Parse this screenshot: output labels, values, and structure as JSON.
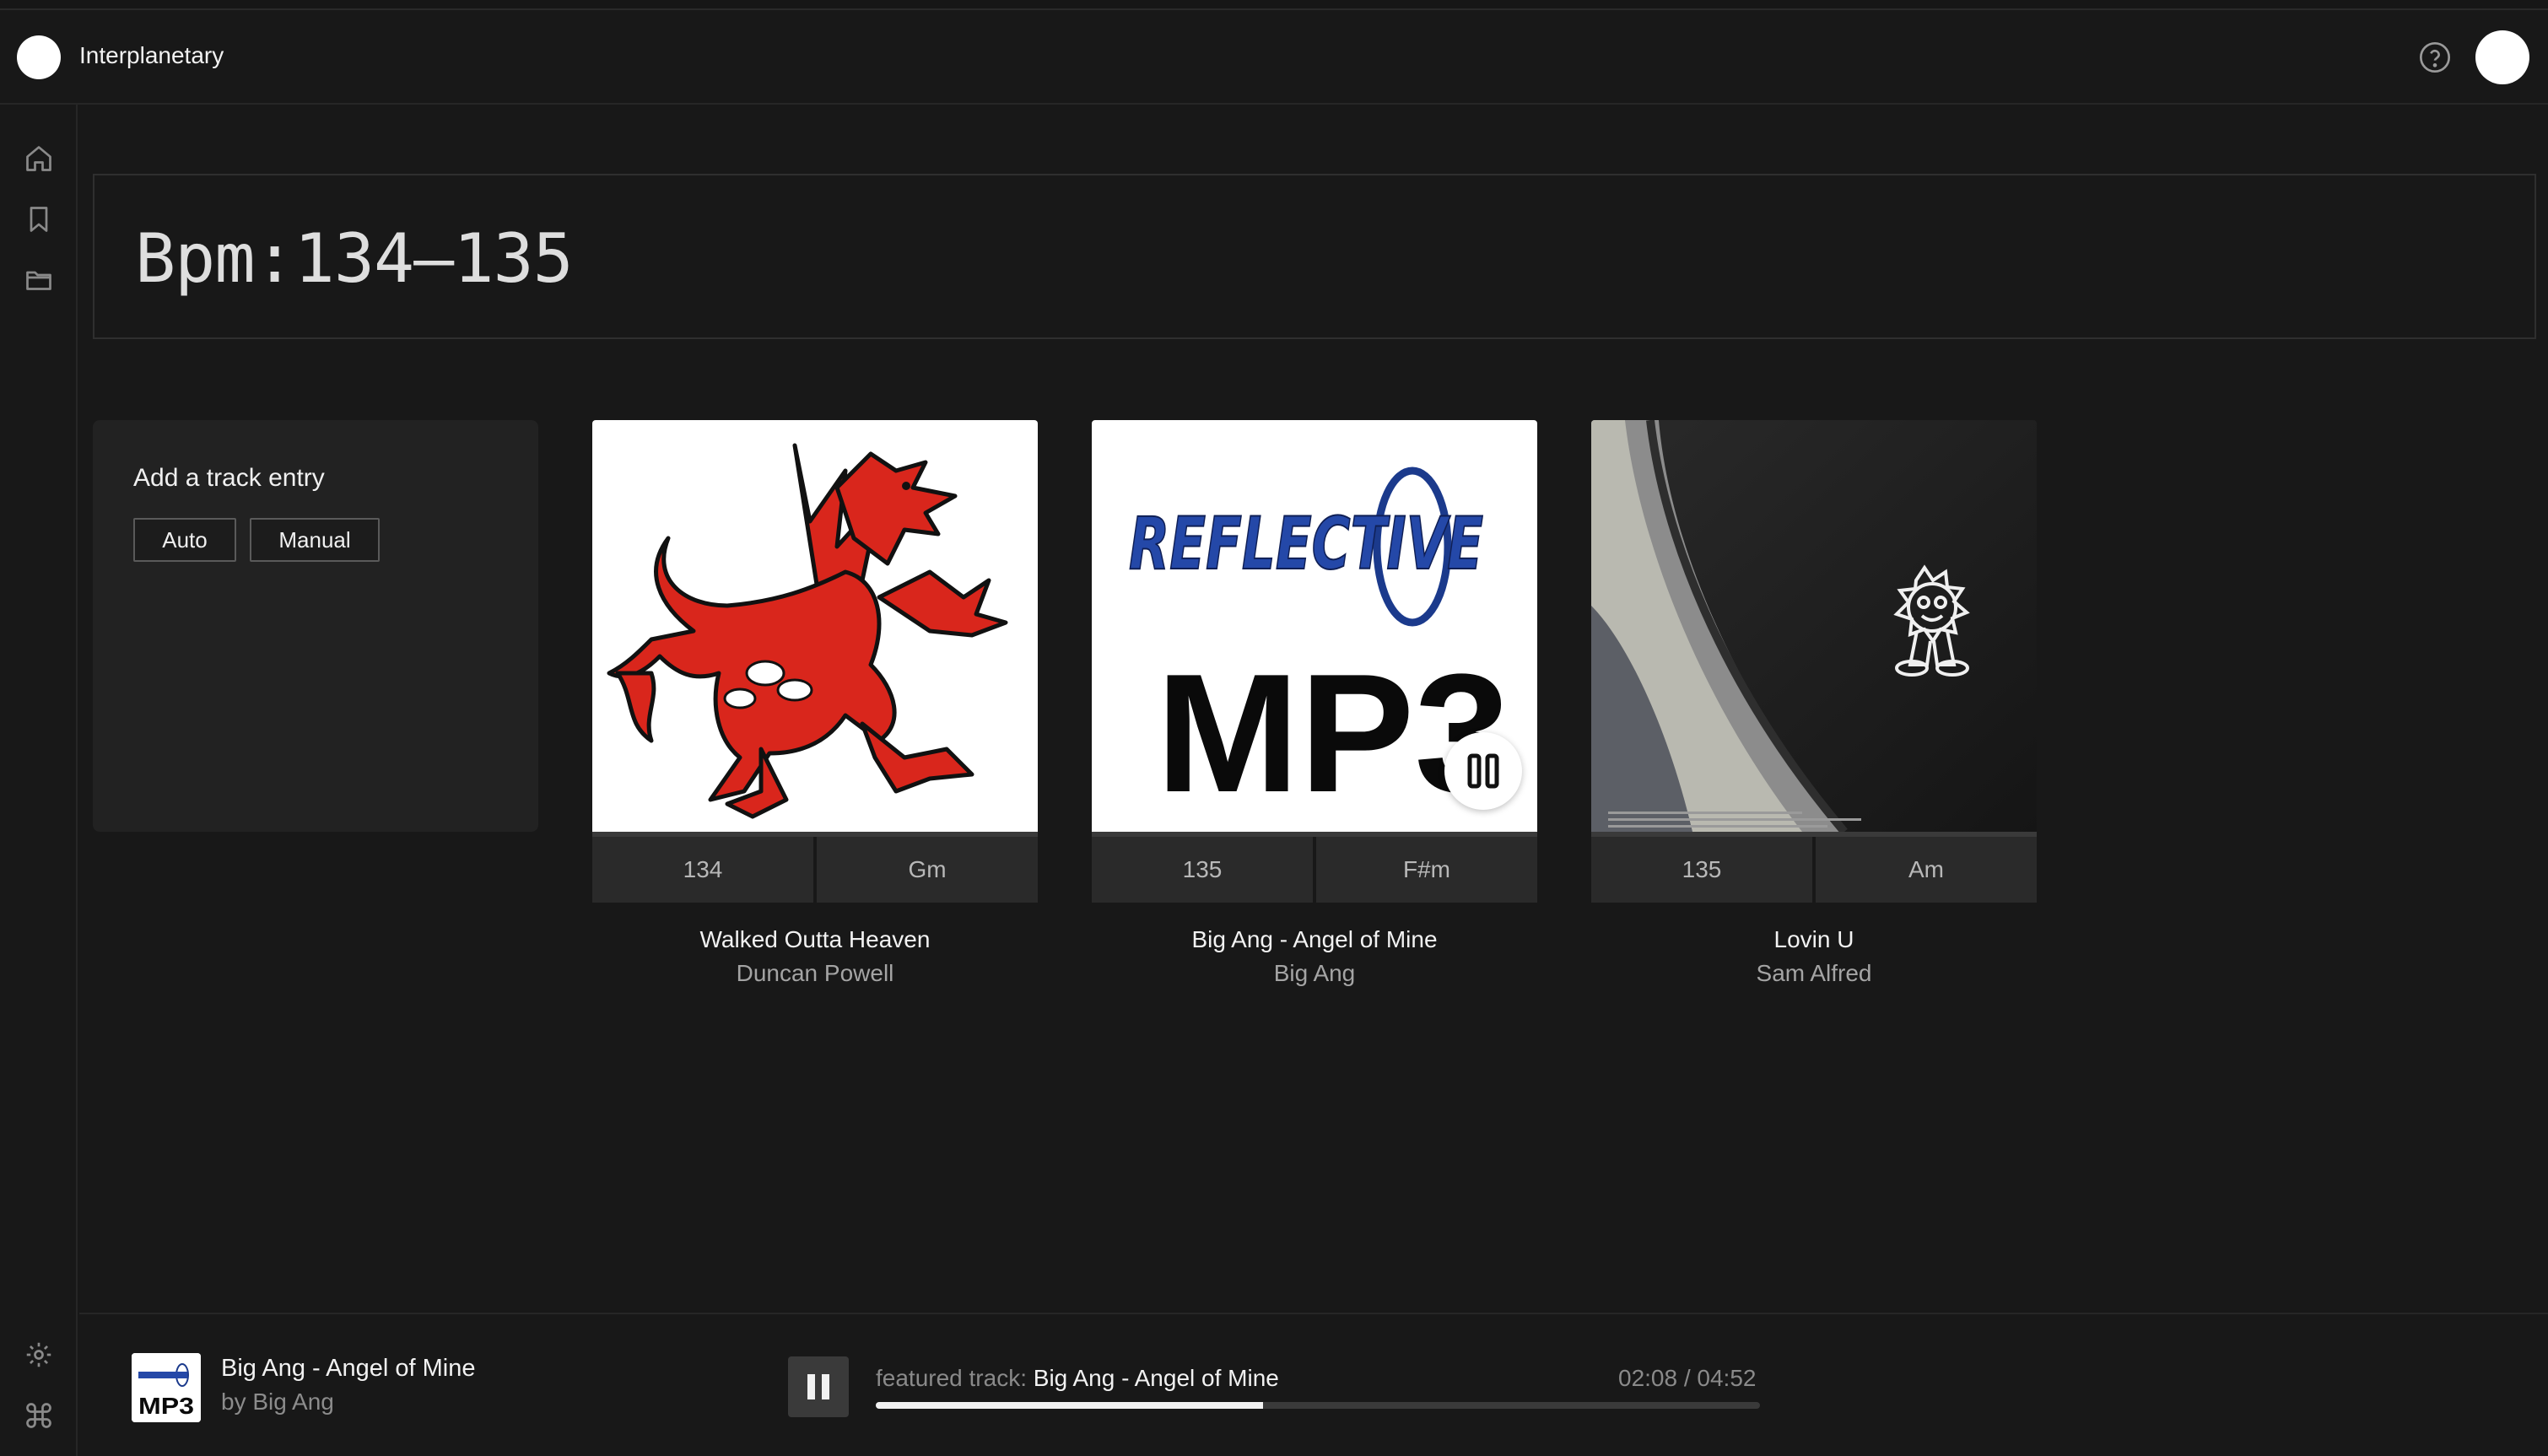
{
  "app": {
    "title": "Interplanetary"
  },
  "icons": {
    "help": "help-circle-icon",
    "home": "home-icon",
    "bookmark": "bookmark-icon",
    "folder": "folder-icon",
    "settings": "gear-icon",
    "command": "command-icon",
    "pause": "pause-icon"
  },
  "search": {
    "query": "Bpm:134–135"
  },
  "add_entry": {
    "title": "Add a track entry",
    "auto_label": "Auto",
    "manual_label": "Manual"
  },
  "tracks": [
    {
      "title": "Walked Outta Heaven",
      "artist": "Duncan Powell",
      "bpm": "134",
      "key": "Gm"
    },
    {
      "title": "Big Ang - Angel of Mine",
      "artist": "Big Ang",
      "bpm": "135",
      "key": "F#m",
      "cover_text": "MP3",
      "cover_brand": "REFLECTIVE"
    },
    {
      "title": "Lovin U",
      "artist": "Sam Alfred",
      "bpm": "135",
      "key": "Am"
    }
  ],
  "player": {
    "track_title": "Big Ang - Angel of Mine",
    "by_line": "by Big Ang",
    "thumb_text": "MP3",
    "featured_prefix": "featured track:",
    "featured_title": "Big Ang - Angel of Mine",
    "time": "02:08 / 04:52",
    "progress": 0.4384
  },
  "colors": {
    "background": "#181818",
    "panel": "#222222",
    "accent": "#f2f2f2",
    "dragon_red": "#d9261c"
  }
}
